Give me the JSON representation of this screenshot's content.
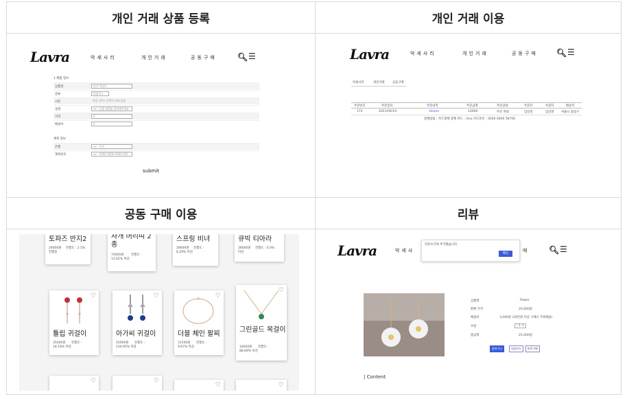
{
  "panels": {
    "tl": {
      "title": "개인 거래 상품 등록"
    },
    "tr": {
      "title": "개인 거래 이용"
    },
    "bl": {
      "title": "공동 구매 이용"
    },
    "br": {
      "title": "리뷰"
    }
  },
  "brand": "Lavra",
  "nav": [
    "악세사리",
    "개인거래",
    "공동구매"
  ],
  "reg": {
    "section1": "1.제품 정보",
    "section2": "계좌 정보",
    "rows": [
      {
        "label": "상품명",
        "value": "분석 목걸이"
      },
      {
        "label": "종류",
        "value": "목걸이 ▾"
      },
      {
        "label": "사진",
        "value": "파일 선택 | 선택된 파일 없음"
      },
      {
        "label": "설명",
        "value": "ex : 상품 설명을 입력해주세요"
      },
      {
        "label": "가격",
        "value": "0"
      },
      {
        "label": "배송비",
        "value": "0"
      }
    ],
    "rows2": [
      {
        "label": "은행",
        "value": "ex : 우리"
      },
      {
        "label": "계좌번호",
        "value": "ex : 0000 0000 0000 000"
      }
    ],
    "submit": "submit"
  },
  "usage": {
    "tabs": [
      "악세사리",
      "개인거래",
      "공동구매"
    ],
    "headers": [
      "주문번호",
      "주문일자",
      "주문내역",
      "주문금액",
      "주문상태",
      "주문자",
      "수령자",
      "배송지"
    ],
    "row": [
      "172",
      "2021/06/19",
      "bloom",
      "10000",
      "주문 완료",
      "임민영",
      "임민영",
      "서울시 중랑구"
    ],
    "payment": "결제방법 : 카드결제     결제 카드 : Visa 카드번호 : 0000 0000 58700"
  },
  "group": {
    "top": [
      {
        "name": "토파즈 반지2",
        "price": "28000원",
        "progress": "진행도 : 2.5%",
        "extra": "진행중"
      },
      {
        "name": "자개 머리띠 2 종",
        "price": "74000원",
        "progress": "진행도 :",
        "extra": "12.62% 마감"
      },
      {
        "name": "스프링 비녀",
        "price": "28000원",
        "progress": "진행도 :",
        "extra": "8.29% 마감"
      },
      {
        "name": "큐빅 티아라",
        "price": "28000원",
        "progress": "진행도 : 0.0%",
        "extra": "마감"
      }
    ],
    "mid": [
      {
        "name": "튤립 귀걸이",
        "price": "35000원",
        "progress": "진행도 :",
        "extra": "18.18% 마감"
      },
      {
        "name": "아가씨 귀걸이",
        "price": "25000원",
        "progress": "진행도 :",
        "extra": "130.95% 마감"
      },
      {
        "name": "더블 체인 팔찌",
        "price": "31500원",
        "progress": "진행도 :",
        "extra": "9.67% 마감"
      },
      {
        "name": "그린골드 목걸이",
        "price": "18000원",
        "progress": "진행도 :",
        "extra": "88.89% 마감"
      }
    ]
  },
  "review": {
    "popup": "리뷰쓰기에 추가했습니다.",
    "popup_btn": "확인",
    "nav_partial": "악세사",
    "nav_partial2": "매",
    "rows": [
      {
        "label": "상품명",
        "value": "flower"
      },
      {
        "label": "판매 가격",
        "value": "20,000원"
      },
      {
        "label": "배송비",
        "value": "3,000원 (30만원 이상 구매시 무료배송)"
      },
      {
        "label": "수량",
        "value": "- 1 +"
      },
      {
        "label": "총금액",
        "value": "25,000원"
      }
    ],
    "buttons": [
      "장바구니",
      "리뷰쓰기",
      "바로구매"
    ],
    "content": "| Content"
  },
  "colors": {
    "accent": "#3b5bdb",
    "red": "#d33"
  }
}
